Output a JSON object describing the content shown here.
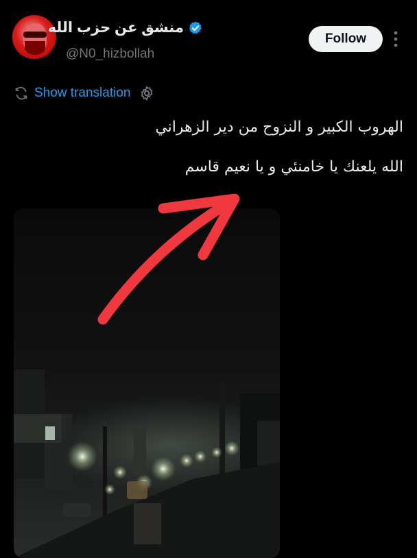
{
  "author": {
    "display_name": "منشق عن حزب الله",
    "handle": "@N0_hizbollah",
    "verified": true,
    "avatar_icon": "avatar-image"
  },
  "actions": {
    "follow_label": "Follow",
    "more_icon": "more-vertical-icon"
  },
  "translation": {
    "label": "Show translation",
    "icon": "translate-icon",
    "settings_icon": "gear-icon"
  },
  "tweet": {
    "lines": [
      "الهروب الكبير و النزوح من دير الزهراني",
      "الله يلعنك يا خامنئي و يا نعيم قاسم"
    ]
  },
  "media": {
    "type": "video-still",
    "annotation": "red-arrow"
  },
  "colors": {
    "background": "#000000",
    "text": "#e7e9ea",
    "muted": "#71767b",
    "link": "#1d9bf0",
    "follow_bg": "#eff3f4",
    "verified": "#1d9bf0",
    "arrow": "#f0383e"
  }
}
